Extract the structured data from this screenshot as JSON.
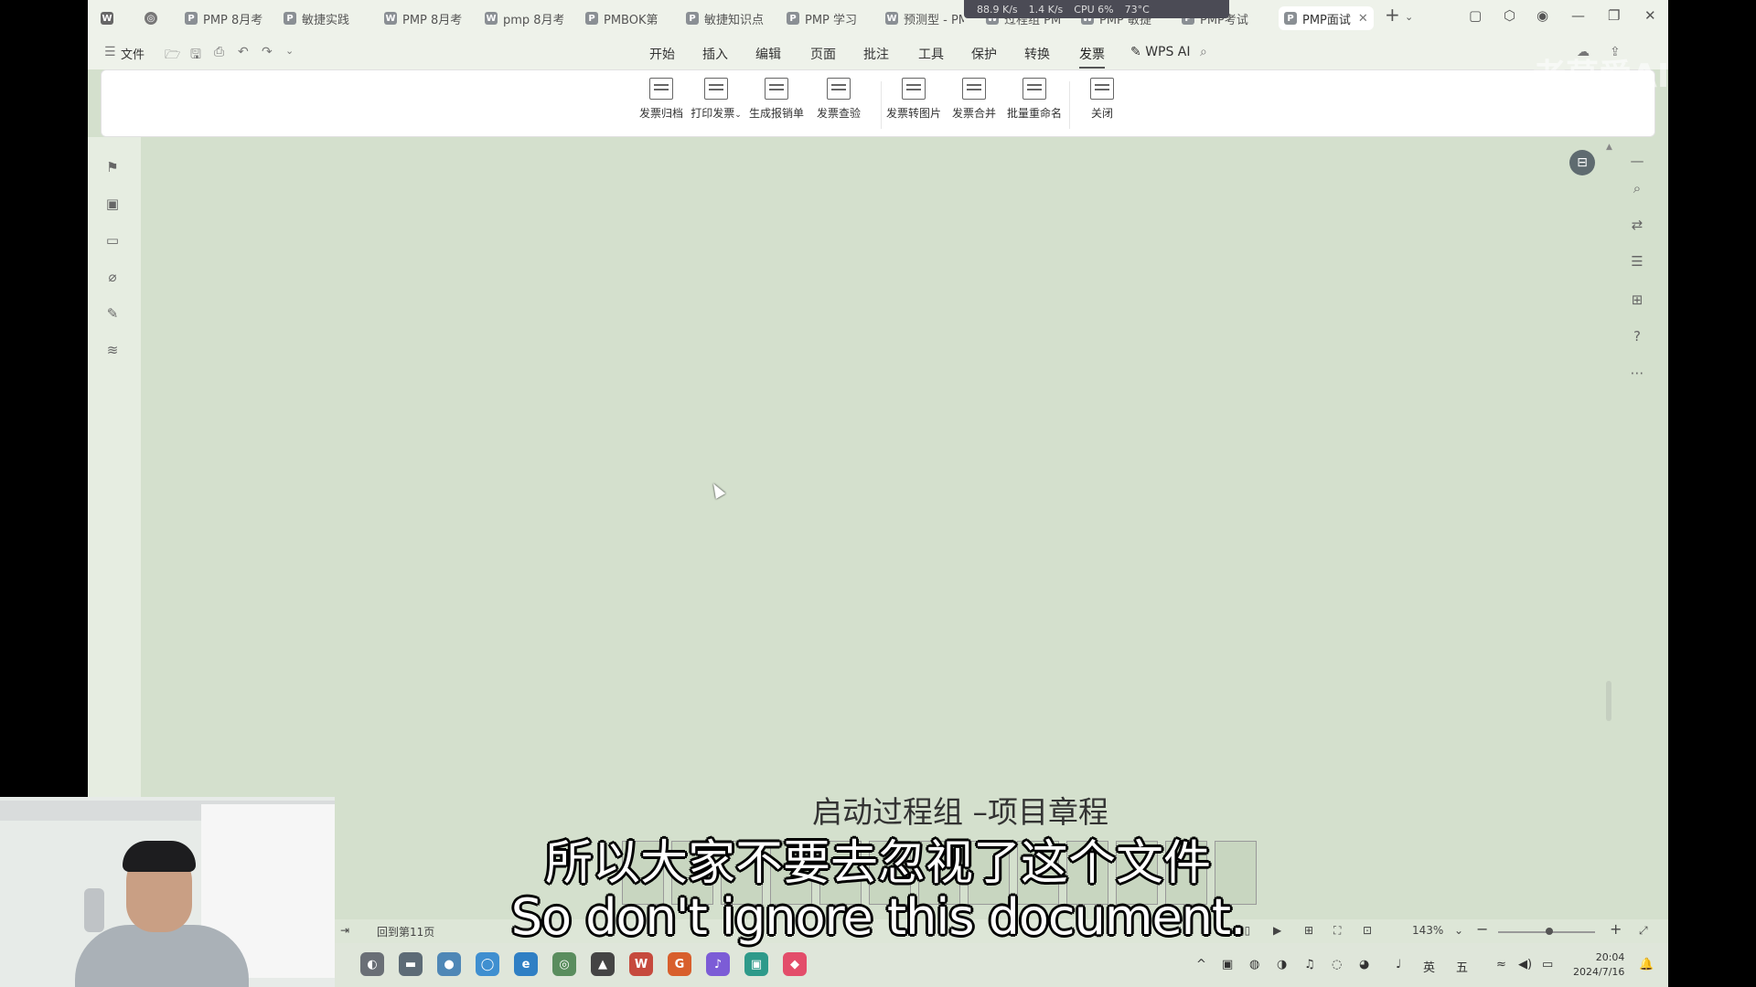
{
  "window": {
    "tabs": [
      {
        "label": "PMP 8月考",
        "icon": "P"
      },
      {
        "label": "敏捷实践",
        "icon": "P"
      },
      {
        "label": "PMP 8月考",
        "icon": "W"
      },
      {
        "label": "pmp 8月考",
        "icon": "W"
      },
      {
        "label": "PMBOK第",
        "icon": "P"
      },
      {
        "label": "敏捷知识点",
        "icon": "P"
      },
      {
        "label": "PMP 学习",
        "icon": "P"
      },
      {
        "label": "预测型 - PM",
        "icon": "W"
      },
      {
        "label": "过程组 PM",
        "icon": "W"
      },
      {
        "label": "PMP 敏捷",
        "icon": "W"
      },
      {
        "label": "PMP考试",
        "icon": "P"
      }
    ],
    "active_tab": {
      "label": "PMP面试",
      "icon": "P"
    },
    "net_stats": [
      "88.9 K/s",
      "1.4 K/s",
      "CPU 6%",
      "73°C"
    ]
  },
  "menubar": {
    "file_label": "文件",
    "items": [
      "开始",
      "插入",
      "编辑",
      "页面",
      "批注",
      "工具",
      "保护",
      "转换",
      "发票"
    ],
    "active_item": "发票",
    "ai_label": "WPS AI"
  },
  "ribbon": {
    "buttons": [
      {
        "label": "发票归档",
        "icon": "archive-icon"
      },
      {
        "label": "打印发票",
        "icon": "print-icon",
        "dropdown": true
      },
      {
        "label": "生成报销单",
        "icon": "table-icon"
      },
      {
        "label": "发票查验",
        "icon": "verify-icon"
      },
      {
        "label": "发票转图片",
        "icon": "image-convert-icon"
      },
      {
        "label": "发票合并",
        "icon": "merge-icon"
      },
      {
        "label": "批量重命名",
        "icon": "rename-icon"
      },
      {
        "label": "关闭",
        "icon": "close-icon"
      }
    ]
  },
  "document": {
    "slide_title": "启动过程组 –项目章程"
  },
  "subtitles": {
    "zh": "所以大家不要去忽视了这个文件",
    "en": "So don't ignore this document."
  },
  "statusbar": {
    "page_label": "回到第11页",
    "zoom": "143%"
  },
  "taskbar": {
    "clock_time": "20:04",
    "clock_date": "2024/7/16",
    "ime_lang": "英",
    "ime_mode": "五"
  },
  "watermark": "老莫爱AI bili"
}
